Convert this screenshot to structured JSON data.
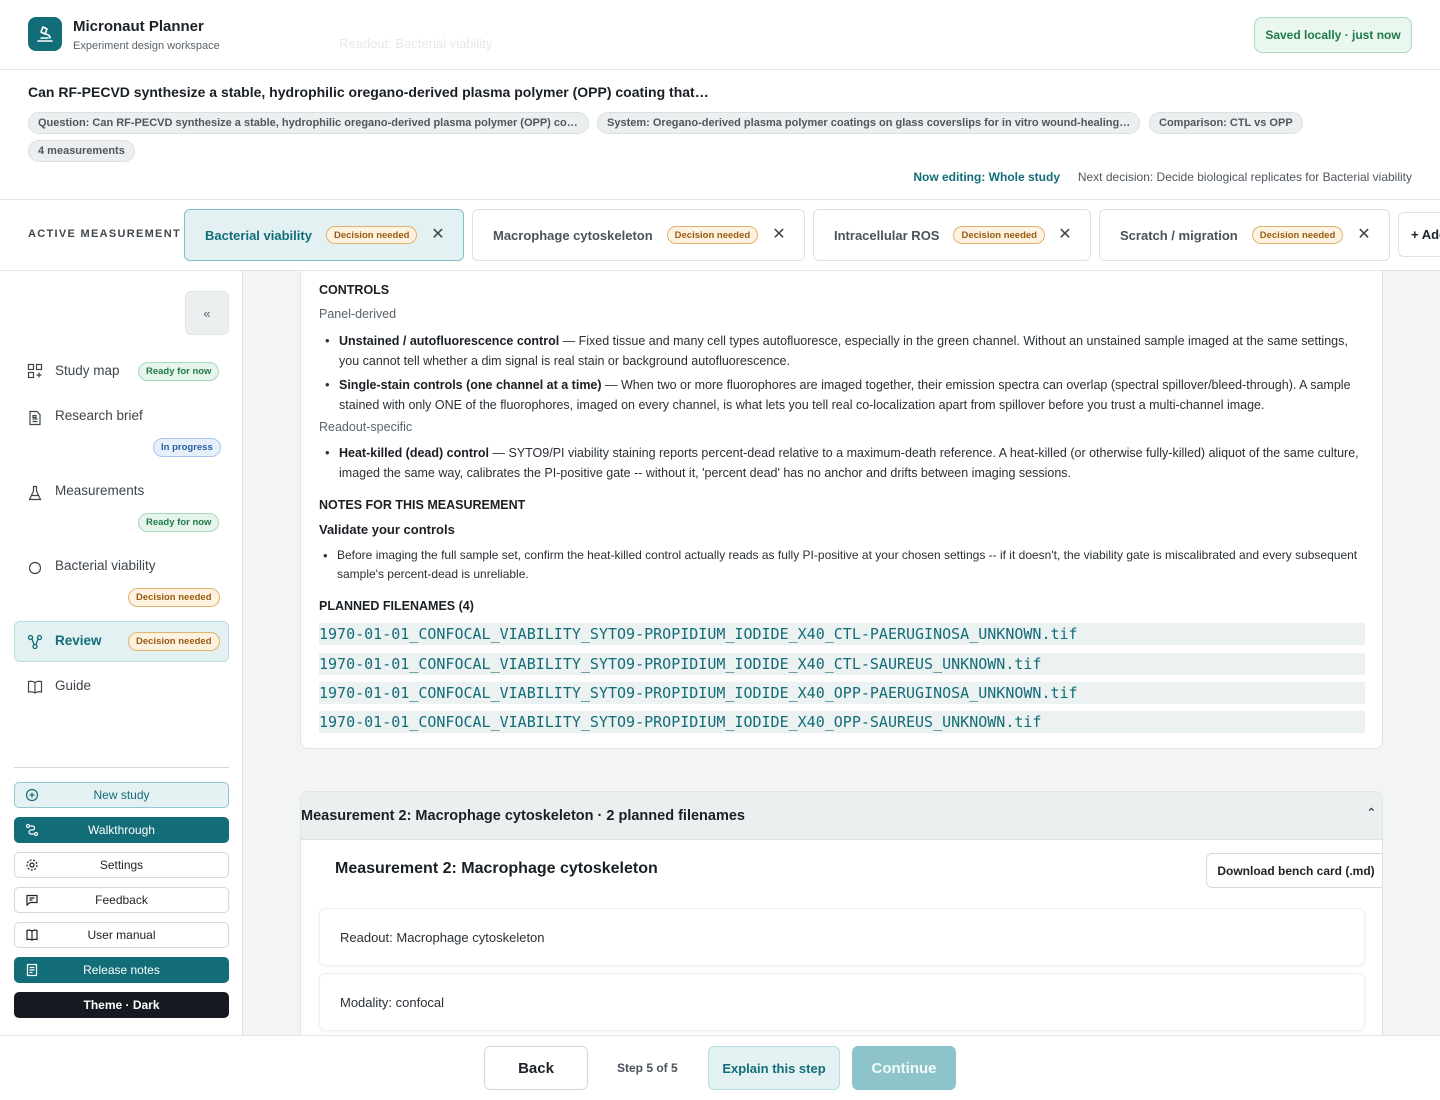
{
  "app": {
    "title": "Micronaut Planner",
    "subtitle": "Experiment design workspace",
    "ghost_text": "Readout: Bacterial viability",
    "saved_status": "Saved locally · just now"
  },
  "study": {
    "title": "Can RF-PECVD synthesize a stable, hydrophilic oregano-derived plasma polymer (OPP) coating that…",
    "chips": [
      "Question: Can RF-PECVD synthesize a stable, hydrophilic oregano-derived plasma polymer (OPP) co…",
      "System: Oregano-derived plasma polymer coatings on glass coverslips for in vitro wound-healing…",
      "Comparison: CTL vs OPP",
      "4 measurements"
    ],
    "now_editing": "Now editing: Whole study",
    "next_decision": "Next decision: Decide biological replicates for Bacterial viability"
  },
  "measurement_tabs": {
    "label": "ACTIVE MEASUREMENT",
    "tabs": [
      {
        "label": "Bacterial viability",
        "badge": "Decision needed",
        "active": true
      },
      {
        "label": "Macrophage cytoskeleton",
        "badge": "Decision needed",
        "active": false
      },
      {
        "label": "Intracellular ROS",
        "badge": "Decision needed",
        "active": false
      },
      {
        "label": "Scratch / migration",
        "badge": "Decision needed",
        "active": false
      }
    ],
    "close_glyph": "✕",
    "add_label": "+ Add"
  },
  "sidebar": {
    "collapse_label": "«",
    "items": [
      {
        "label": "Study map",
        "badge": "Ready for now",
        "icon": "grid-icon"
      },
      {
        "label": "Research brief",
        "badge": "In progress",
        "icon": "document-icon"
      },
      {
        "label": "Measurements",
        "badge": "Ready for now",
        "icon": "flask-icon"
      },
      {
        "label": "Bacterial viability",
        "badge": "Decision needed",
        "icon": "circle-icon"
      },
      {
        "label": "Review",
        "badge": "Decision needed",
        "icon": "network-icon"
      },
      {
        "label": "Guide",
        "icon": "book-icon"
      }
    ],
    "buttons": {
      "new_study": "New study",
      "walkthrough": "Walkthrough",
      "settings": "Settings",
      "feedback": "Feedback",
      "user_manual": "User manual",
      "release_notes": "Release notes",
      "theme": "Theme · Dark"
    }
  },
  "measurement1": {
    "controls_heading": "CONTROLS",
    "panel_derived": "Panel-derived",
    "controls": [
      {
        "title": "Unstained / autofluorescence control",
        "text": " — Fixed tissue and many cell types autofluoresce, especially in the green channel. Without an unstained sample imaged at the same settings, you cannot tell whether a dim signal is real stain or background autofluorescence."
      },
      {
        "title": "Single-stain controls (one channel at a time)",
        "text": " — When two or more fluorophores are imaged together, their emission spectra can overlap (spectral spillover/bleed-through). A sample stained with only ONE of the fluorophores, imaged on every channel, is what lets you tell real co-localization apart from spillover before you trust a multi-channel image."
      }
    ],
    "readout_specific": "Readout-specific",
    "readout_controls": [
      {
        "title": "Heat-killed (dead) control",
        "text": " — SYTO9/PI viability staining reports percent-dead relative to a maximum-death reference. A heat-killed (or otherwise fully-killed) aliquot of the same culture, imaged the same way, calibrates the PI-positive gate -- without it, 'percent dead' has no anchor and drifts between imaging sessions."
      }
    ],
    "notes_heading": "NOTES FOR THIS MEASUREMENT",
    "notes_subheading": "Validate your controls",
    "notes": [
      "Before imaging the full sample set, confirm the heat-killed control actually reads as fully PI-positive at your chosen settings -- if it doesn't, the viability gate is miscalibrated and every subsequent sample's percent-dead is unreliable."
    ],
    "filenames_heading": "PLANNED FILENAMES (4)",
    "filenames": [
      "1970-01-01_CONFOCAL_VIABILITY_SYTO9-PROPIDIUM_IODIDE_X40_CTL-PAERUGINOSA_UNKNOWN.tif",
      "1970-01-01_CONFOCAL_VIABILITY_SYTO9-PROPIDIUM_IODIDE_X40_CTL-SAUREUS_UNKNOWN.tif",
      "1970-01-01_CONFOCAL_VIABILITY_SYTO9-PROPIDIUM_IODIDE_X40_OPP-PAERUGINOSA_UNKNOWN.tif",
      "1970-01-01_CONFOCAL_VIABILITY_SYTO9-PROPIDIUM_IODIDE_X40_OPP-SAUREUS_UNKNOWN.tif"
    ]
  },
  "measurement2": {
    "header": "Measurement 2: Macrophage cytoskeleton · 2 planned filenames",
    "chevron": "⌃",
    "title": "Measurement 2: Macrophage cytoskeleton",
    "download_label": "Download bench card (.md)",
    "readout": "Readout: Macrophage cytoskeleton",
    "modality": "Modality: confocal"
  },
  "footer": {
    "back": "Back",
    "step": "Step 5 of 5",
    "explain": "Explain this step",
    "continue": "Continue"
  },
  "colors": {
    "accent": "#126d78",
    "decision_badge": "#fdf2df",
    "ready_badge": "#e6f5ec"
  }
}
